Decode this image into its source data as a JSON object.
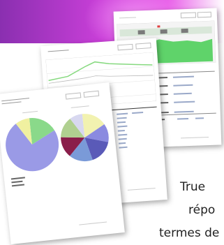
{
  "banner": {
    "gradient_start": "#8a2fb0",
    "gradient_end": "#e85fe8"
  },
  "body_text": {
    "line1": "True",
    "line2": "répo",
    "line3": "termes de"
  }
}
